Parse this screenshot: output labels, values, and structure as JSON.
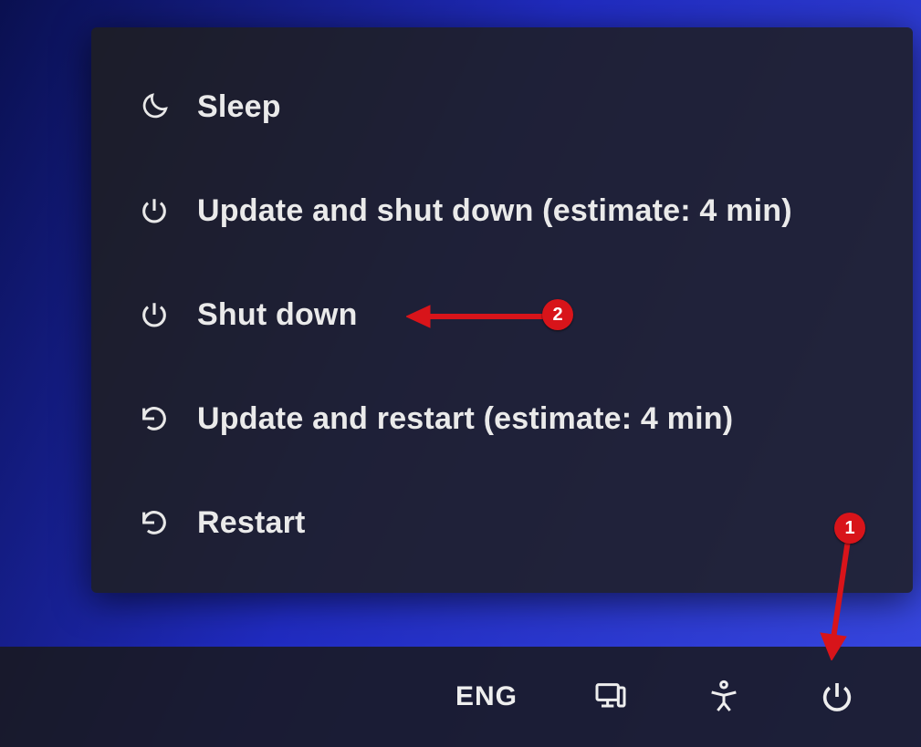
{
  "power_menu": {
    "items": [
      {
        "icon": "moon",
        "label": "Sleep"
      },
      {
        "icon": "power",
        "label": "Update and shut down (estimate: 4 min)"
      },
      {
        "icon": "power",
        "label": "Shut down"
      },
      {
        "icon": "restart",
        "label": "Update and restart (estimate: 4 min)"
      },
      {
        "icon": "restart",
        "label": "Restart"
      }
    ]
  },
  "taskbar": {
    "language": "ENG"
  },
  "annotations": {
    "badge1": "1",
    "badge2": "2"
  }
}
